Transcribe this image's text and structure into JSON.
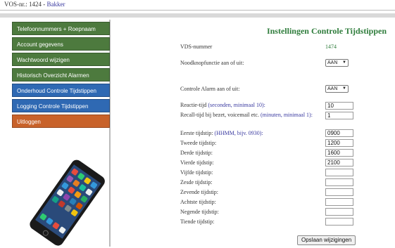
{
  "header": {
    "vos_prefix": "VOS-nr.: 1424 - ",
    "vos_link": "Bakker"
  },
  "sidebar": {
    "items": [
      {
        "label": "Telefoonnummers + Roepnaam"
      },
      {
        "label": "Account gegevens"
      },
      {
        "label": "Wachtwoord wijzigen"
      },
      {
        "label": "Historisch Overzicht Alarmen"
      },
      {
        "label": "Onderhoud Controle Tijdstippen"
      },
      {
        "label": "Logging Controle Tijdstippen"
      },
      {
        "label": "Uitloggen"
      }
    ],
    "colors": {
      "green": "#4d7a3e",
      "blue": "#2f69b3",
      "orange": "#c8622a"
    }
  },
  "main": {
    "title": "Instellingen Controle Tijdstippen",
    "vds_label": "VDS-nummer",
    "vds_value": "1474",
    "nood_label": "Noodknopfunctie aan of uit:",
    "nood_value": "AAN",
    "alarm_label": "Controle Alarm aan of uit:",
    "alarm_value": "AAN",
    "reactie_label": "Reactie-tijd ",
    "reactie_hint": "(seconden, minimaal 10):",
    "reactie_value": "10",
    "recall_label": "Recall-tijd bij bezet, voicemail etc. ",
    "recall_hint": "(minuten, minimaal 1):",
    "recall_value": "1",
    "times": [
      {
        "label": "Eerste tijdstip: ",
        "hint": "(HHMM, bijv. 0930):",
        "value": "0900"
      },
      {
        "label": "Tweede tijdstip:",
        "hint": "",
        "value": "1200"
      },
      {
        "label": "Derde tijdstip:",
        "hint": "",
        "value": "1600"
      },
      {
        "label": "Vierde tijdstip:",
        "hint": "",
        "value": "2100"
      },
      {
        "label": "Vijfde tijdstip:",
        "hint": "",
        "value": ""
      },
      {
        "label": "Zesde tijdstip:",
        "hint": "",
        "value": ""
      },
      {
        "label": "Zevende tijdstip:",
        "hint": "",
        "value": ""
      },
      {
        "label": "Achtste tijdstip:",
        "hint": "",
        "value": ""
      },
      {
        "label": "Negende tijdstip:",
        "hint": "",
        "value": ""
      },
      {
        "label": "Tiende tijdstip:",
        "hint": "",
        "value": ""
      }
    ],
    "save_label": "Opslaan wijzigingen"
  }
}
